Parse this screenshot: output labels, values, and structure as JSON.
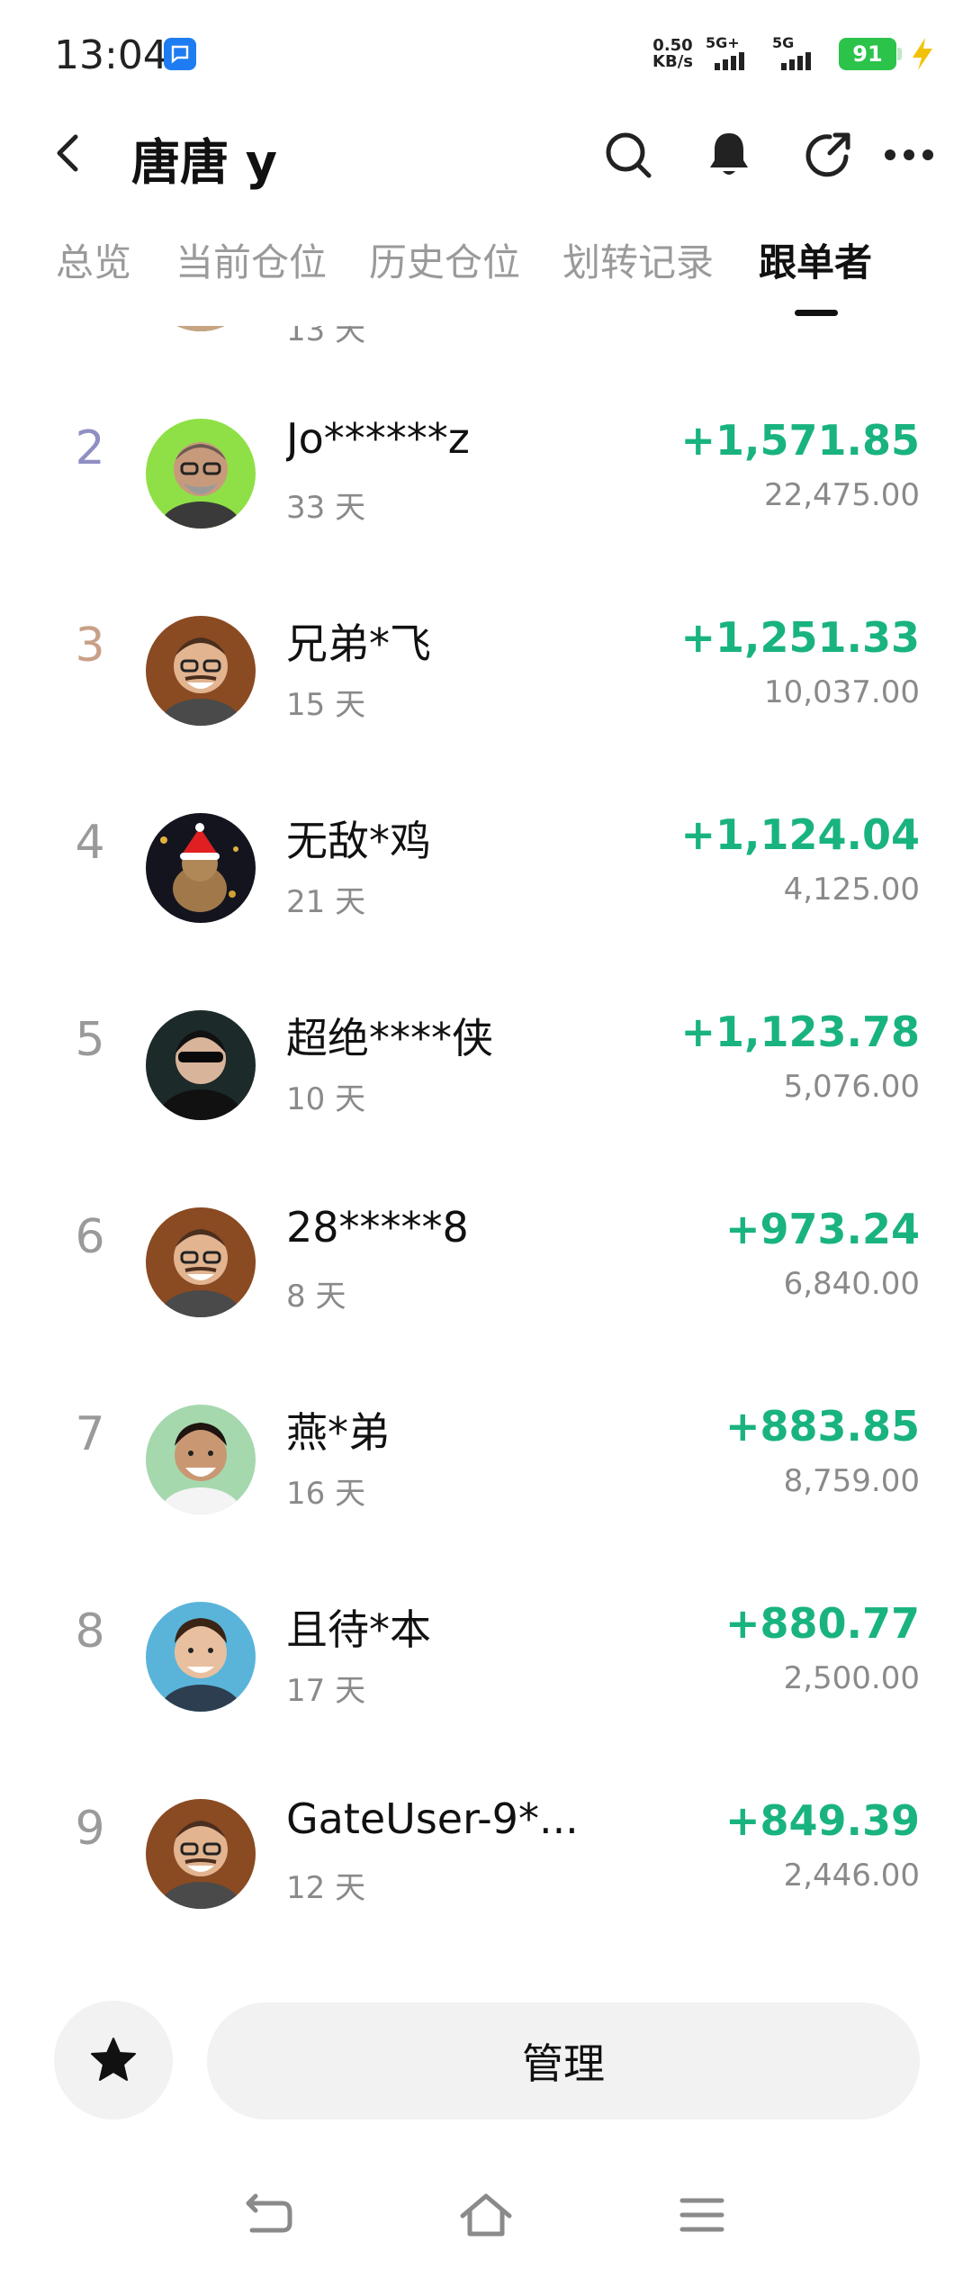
{
  "status_bar": {
    "time": "13:04",
    "net_speed_value": "0.50",
    "net_speed_unit": "KB/s",
    "sim1_label": "5G+",
    "sim2_label": "5G",
    "battery_level": "91"
  },
  "header": {
    "title": "唐唐 y"
  },
  "tabs": [
    {
      "label": "总览",
      "active": false
    },
    {
      "label": "当前仓位",
      "active": false
    },
    {
      "label": "历史仓位",
      "active": false
    },
    {
      "label": "划转记录",
      "active": false
    },
    {
      "label": "跟单者",
      "active": true
    }
  ],
  "followers": [
    {
      "rank": "2",
      "name": "Jo******z",
      "days": "33 天",
      "profit": "+1,571.85",
      "amount": "22,475.00",
      "rank_color": "#8f8fc4"
    },
    {
      "rank": "3",
      "name": "兄弟*飞",
      "days": "15 天",
      "profit": "+1,251.33",
      "amount": "10,037.00",
      "rank_color": "#c8a088"
    },
    {
      "rank": "4",
      "name": "无敌*鸡",
      "days": "21 天",
      "profit": "+1,124.04",
      "amount": "4,125.00",
      "rank_color": "#9a9a9a"
    },
    {
      "rank": "5",
      "name": "超绝****侠",
      "days": "10 天",
      "profit": "+1,123.78",
      "amount": "5,076.00",
      "rank_color": "#9a9a9a"
    },
    {
      "rank": "6",
      "name": "28*****8",
      "days": "8 天",
      "profit": "+973.24",
      "amount": "6,840.00",
      "rank_color": "#9a9a9a"
    },
    {
      "rank": "7",
      "name": "燕*弟",
      "days": "16 天",
      "profit": "+883.85",
      "amount": "8,759.00",
      "rank_color": "#9a9a9a"
    },
    {
      "rank": "8",
      "name": "且待*本",
      "days": "17 天",
      "profit": "+880.77",
      "amount": "2,500.00",
      "rank_color": "#9a9a9a"
    },
    {
      "rank": "9",
      "name": "GateUser-9*...",
      "days": "12 天",
      "profit": "+849.39",
      "amount": "2,446.00",
      "rank_color": "#9a9a9a"
    }
  ],
  "partial_row": {
    "days": "13 天"
  },
  "actions": {
    "manage_label": "管理"
  },
  "colors": {
    "profit": "#19b37f",
    "muted": "#8a8a8a",
    "button_bg": "#f2f2f2"
  },
  "icons": {
    "back": "back-arrow-icon",
    "search": "search-icon",
    "bell": "bell-icon",
    "share": "share-icon",
    "more": "more-icon",
    "star": "star-icon"
  }
}
